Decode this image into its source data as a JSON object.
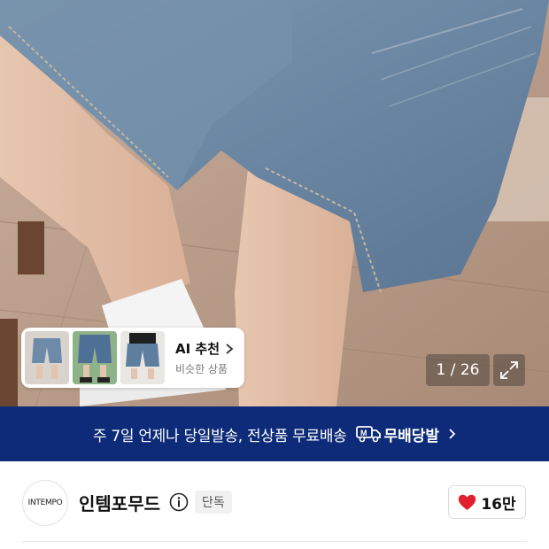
{
  "product_image": {
    "image_counter": "1 / 26",
    "ai_recommend": {
      "title": "AI 추천",
      "subtitle": "비슷한 상품",
      "thumbnails": [
        "thumb-shorts-1",
        "thumb-shorts-2",
        "thumb-shorts-3"
      ]
    },
    "expand_icon": "expand-icon"
  },
  "shipping_banner": {
    "text": "주 7일 언제나 당일발송, 전상품 무료배송",
    "brand": "무배당발",
    "icon": "truck-icon"
  },
  "brand": {
    "logo_text": "INTEMPO",
    "name": "인템포무드",
    "badge": "단독"
  },
  "like": {
    "count": "16만",
    "icon": "heart-icon"
  },
  "colors": {
    "banner_bg": "#0d2b78",
    "heart": "#e0202b",
    "denim": "#6f8aa6"
  }
}
